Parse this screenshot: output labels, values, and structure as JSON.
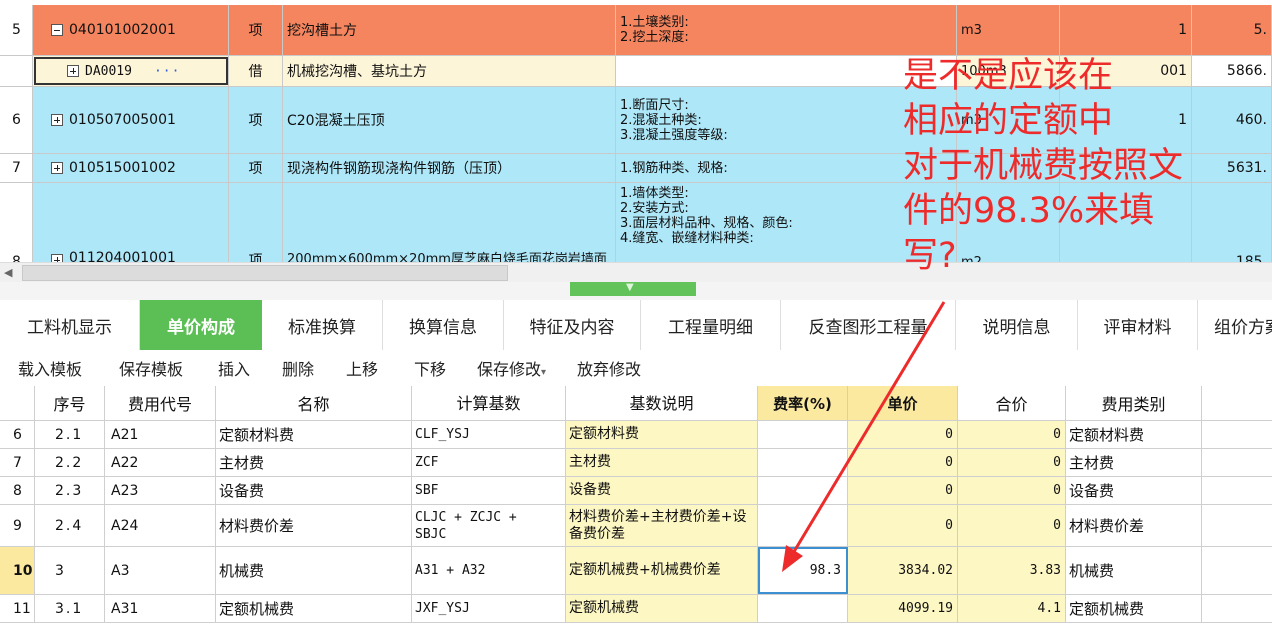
{
  "upper_rows": [
    {
      "row": "5",
      "code": "040101002001",
      "category": "项",
      "name": "挖沟槽土方",
      "features": "1.土壤类别:\n2.挖土深度:",
      "unit": "m3",
      "qty": "1",
      "price": "5.",
      "style": "orange",
      "expander": "minus"
    },
    {
      "row": "",
      "code": "DA0019",
      "dots": "···",
      "category": "借",
      "name": "机械挖沟槽、基坑土方",
      "features": "",
      "unit": "100m3",
      "qty": "001",
      "price": "5866.",
      "style": "cream",
      "expander": "plus"
    },
    {
      "row": "6",
      "code": "010507005001",
      "category": "项",
      "name": "C20混凝土压顶",
      "features": "1.断面尺寸:\n2.混凝土种类:\n3.混凝土强度等级:",
      "unit": "m3",
      "qty": "1",
      "price": "460.",
      "style": "blue",
      "expander": "plus"
    },
    {
      "row": "7",
      "code": "010515001002",
      "category": "项",
      "name": "现浇构件钢筋现浇构件钢筋（压顶）",
      "features": "1.钢筋种类、规格:",
      "unit": "",
      "qty": "",
      "price": "5631.",
      "style": "blue",
      "expander": "plus"
    },
    {
      "row": "8",
      "code": "011204001001",
      "category": "项",
      "name": "200mm×600mm×20mm厚芝麻白烧毛面花岗岩墙面",
      "features": "1.墙体类型:\n2.安装方式:\n3.面层材料品种、规格、颜色:\n4.缝宽、嵌缝材料种类:",
      "unit": "m2",
      "qty": "",
      "price": "185.",
      "style": "blue",
      "expander": "plus"
    }
  ],
  "tabs": [
    {
      "label": "工料机显示"
    },
    {
      "label": "单价构成",
      "active": true
    },
    {
      "label": "标准换算"
    },
    {
      "label": "换算信息"
    },
    {
      "label": "特征及内容"
    },
    {
      "label": "工程量明细"
    },
    {
      "label": "反查图形工程量"
    },
    {
      "label": "说明信息"
    },
    {
      "label": "评审材料"
    },
    {
      "label": "组价方案"
    }
  ],
  "toolbar": {
    "load_template": "载入模板",
    "save_template": "保存模板",
    "insert": "插入",
    "delete": "删除",
    "move_up": "上移",
    "move_down": "下移",
    "save_changes": "保存修改",
    "discard_changes": "放弃修改"
  },
  "lower_headers": [
    "",
    "序号",
    "费用代号",
    "名称",
    "计算基数",
    "基数说明",
    "费率(%)",
    "单价",
    "合价",
    "费用类别",
    ""
  ],
  "lower_rows": [
    {
      "row": "6",
      "seq": "2.1",
      "code": "A21",
      "name": "定额材料费",
      "base": "CLF_YSJ",
      "desc": "定额材料费",
      "rate": "",
      "unit_price": "0",
      "total": "0",
      "type": "定额材料费"
    },
    {
      "row": "7",
      "seq": "2.2",
      "code": "A22",
      "name": "主材费",
      "base": "ZCF",
      "desc": "主材费",
      "rate": "",
      "unit_price": "0",
      "total": "0",
      "type": "主材费"
    },
    {
      "row": "8",
      "seq": "2.3",
      "code": "A23",
      "name": "设备费",
      "base": "SBF",
      "desc": "设备费",
      "rate": "",
      "unit_price": "0",
      "total": "0",
      "type": "设备费"
    },
    {
      "row": "9",
      "seq": "2.4",
      "code": "A24",
      "name": "材料费价差",
      "base": "CLJC + ZCJC +\nSBJC",
      "desc": "材料费价差+主材费价差+设备费价差",
      "rate": "",
      "unit_price": "0",
      "total": "0",
      "type": "材料费价差"
    },
    {
      "row": "10",
      "seq": "3",
      "code": "A3",
      "name": "机械费",
      "base": "A31 + A32",
      "desc": "定额机械费+机械费价差",
      "rate": "98.3",
      "unit_price": "3834.02",
      "total": "3.83",
      "type": "机械费",
      "selected": true
    },
    {
      "row": "11",
      "seq": "3.1",
      "code": "A31",
      "name": "定额机械费",
      "base": "JXF_YSJ",
      "desc": "定额机械费",
      "rate": "",
      "unit_price": "4099.19",
      "total": "4.1",
      "type": "定额机械费"
    }
  ],
  "annotation": {
    "text": "是不是应该在相应的定额中对于机械费按照文件的98.3%来填写?",
    "lines": [
      "是不是应该在",
      "相应的定额中",
      "对于机械费按照文",
      "件的98.3%来填",
      "写?"
    ],
    "color": "#ee2b2b"
  },
  "colors": {
    "active_tab": "#5cbf56",
    "orange_row": "#f5855f",
    "blue_row": "#aee7f8",
    "yellow_cell": "#fdf7c4"
  }
}
